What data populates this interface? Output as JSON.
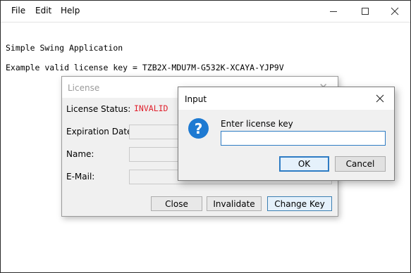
{
  "menu": {
    "file": "File",
    "edit": "Edit",
    "help": "Help"
  },
  "window_controls": {
    "minimize": "minimize-icon",
    "maximize": "maximize-icon",
    "close": "close-icon"
  },
  "content": {
    "app_name": "Simple Swing Application",
    "example_key_line": "Example valid license key = TZB2X-MDU7M-G532K-XCAYA-YJP9V"
  },
  "license_dialog": {
    "title": "License",
    "status_label": "License Status:",
    "status_value": "INVALID",
    "status_color": "#e0202c",
    "expiration_label": "Expiration Date:",
    "name_label": "Name:",
    "email_label": "E-Mail:",
    "close_button": "Close",
    "invalidate_button": "Invalidate",
    "change_key_button": "Change Key"
  },
  "input_dialog": {
    "title": "Input",
    "prompt": "Enter license key",
    "input_value": "",
    "ok_button": "OK",
    "cancel_button": "Cancel",
    "icon": "question-icon",
    "accent_color": "#1e7ad2"
  }
}
